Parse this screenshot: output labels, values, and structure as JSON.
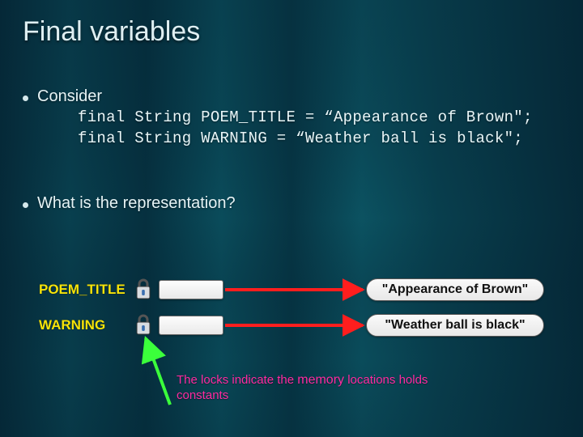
{
  "title": "Final variables",
  "bullets": {
    "consider": "Consider",
    "question": "What is the representation?"
  },
  "code": {
    "line1": "final String POEM_TITLE = “Appearance of Brown\";",
    "line2": "final String WARNING = “Weather ball is black\";"
  },
  "diagram": {
    "vars": [
      {
        "name": "POEM_TITLE",
        "value": "\"Appearance of Brown\""
      },
      {
        "name": "WARNING",
        "value": "\"Weather ball is black\""
      }
    ],
    "caption_pre": "The locks indicate  the ",
    "caption_mem": "memory",
    "caption_post": " locations holds constants"
  },
  "colors": {
    "label": "#f6e40a",
    "caption": "#ff2aa0",
    "arrow_red": "#ff1e1e",
    "arrow_green": "#3bff3b"
  }
}
